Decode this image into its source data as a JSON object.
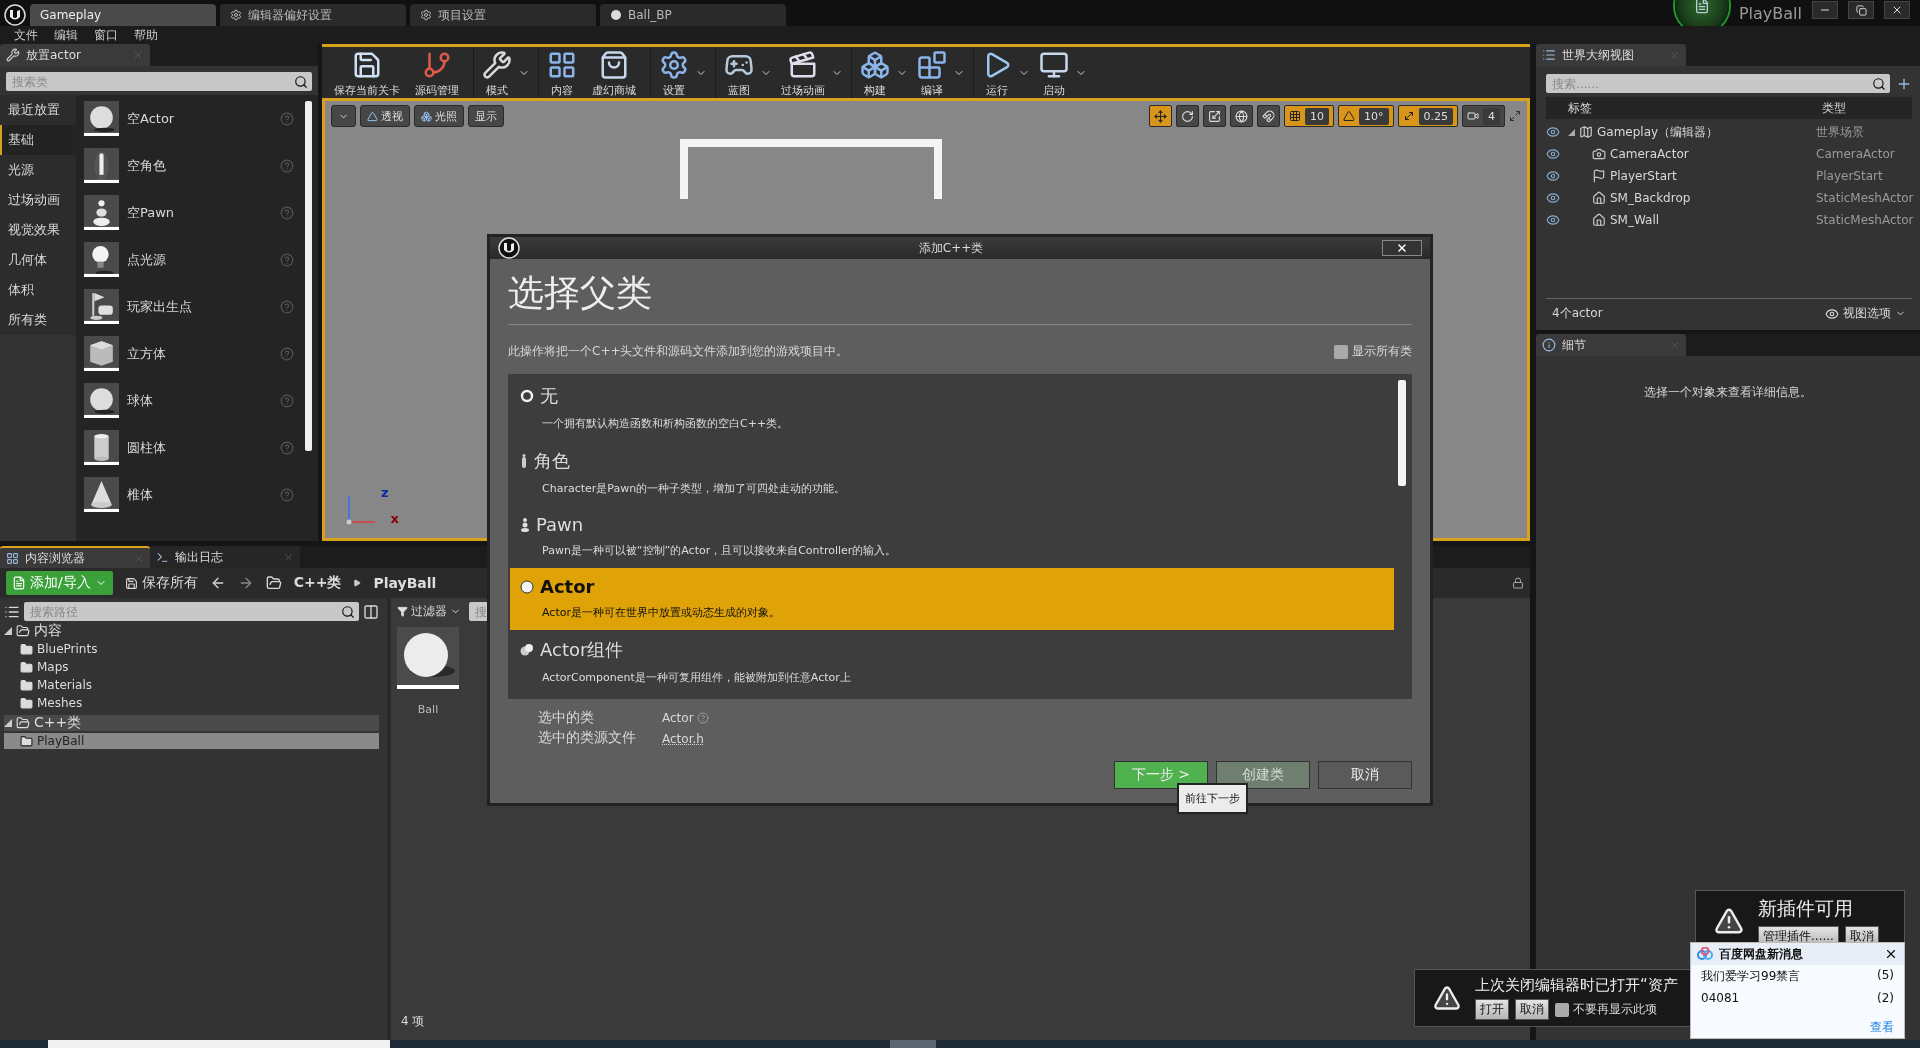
{
  "title_bar": {
    "tabs": [
      {
        "label": "Gameplay",
        "kind": "level",
        "selected": true
      },
      {
        "label": "编辑器偏好设置",
        "kind": "settings",
        "selected": false
      },
      {
        "label": "项目设置",
        "kind": "settings",
        "selected": false
      },
      {
        "label": "Ball_BP",
        "kind": "blueprint",
        "selected": false
      }
    ],
    "project": "PlayBall"
  },
  "menu": [
    "文件",
    "编辑",
    "窗口",
    "帮助"
  ],
  "place_panel": {
    "title": "放置actor",
    "search_placeholder": "搜索类",
    "categories": [
      {
        "label": "最近放置",
        "selected": false
      },
      {
        "label": "基础",
        "selected": true
      },
      {
        "label": "光源",
        "selected": false
      },
      {
        "label": "过场动画",
        "selected": false
      },
      {
        "label": "视觉效果",
        "selected": false
      },
      {
        "label": "几何体",
        "selected": false
      },
      {
        "label": "体积",
        "selected": false
      },
      {
        "label": "所有类",
        "selected": false
      }
    ],
    "items": [
      {
        "label": "空Actor",
        "kind": "sphere"
      },
      {
        "label": "空角色",
        "kind": "figure"
      },
      {
        "label": "空Pawn",
        "kind": "pawn"
      },
      {
        "label": "点光源",
        "kind": "bulb"
      },
      {
        "label": "玩家出生点",
        "kind": "flag"
      },
      {
        "label": "立方体",
        "kind": "cube"
      },
      {
        "label": "球体",
        "kind": "sphere"
      },
      {
        "label": "圆柱体",
        "kind": "cylinder"
      },
      {
        "label": "椎体",
        "kind": "cone"
      }
    ]
  },
  "toolbar": [
    {
      "label": "保存当前关卡",
      "kind": "save",
      "dropdown": false
    },
    {
      "label": "源码管理",
      "kind": "source",
      "dropdown": false
    },
    {
      "label": "模式",
      "kind": "modes",
      "dropdown": true
    },
    {
      "label": "内容",
      "kind": "content",
      "dropdown": false
    },
    {
      "label": "虚幻商城",
      "kind": "market",
      "dropdown": false
    },
    {
      "label": "设置",
      "kind": "settings",
      "dropdown": true
    },
    {
      "label": "蓝图",
      "kind": "blueprint",
      "dropdown": true
    },
    {
      "label": "过场动画",
      "kind": "cinematics",
      "dropdown": true
    },
    {
      "label": "构建",
      "kind": "build",
      "dropdown": true
    },
    {
      "label": "编译",
      "kind": "compile",
      "dropdown": true
    },
    {
      "label": "运行",
      "kind": "play",
      "dropdown": true
    },
    {
      "label": "启动",
      "kind": "launch",
      "dropdown": true
    }
  ],
  "viewport": {
    "view_buttons": [
      {
        "label": "透视",
        "kind": "perspective"
      },
      {
        "label": "光照",
        "kind": "lit"
      },
      {
        "label": "显示",
        "kind": "plain"
      }
    ],
    "tools": [
      {
        "kind": "move",
        "selected": true
      },
      {
        "kind": "rotate",
        "selected": false
      },
      {
        "kind": "scale",
        "selected": false
      },
      {
        "kind": "globe",
        "selected": false
      },
      {
        "kind": "surface",
        "selected": false
      }
    ],
    "snaps": [
      {
        "kind": "grid",
        "value": "10",
        "on": true
      },
      {
        "kind": "angle",
        "value": "10°",
        "on": true
      },
      {
        "kind": "scale",
        "value": "0.25",
        "on": true
      },
      {
        "kind": "camera",
        "value": "4",
        "on": false
      }
    ],
    "axes": [
      "z",
      "x"
    ]
  },
  "outliner": {
    "title": "世界大纲视图",
    "search_placeholder": "搜索......",
    "columns": [
      "标签",
      "类型"
    ],
    "tree": {
      "label": "Gameplay（编辑器）",
      "type": "世界场景",
      "kind": "world",
      "expanded": true,
      "children": [
        {
          "label": "CameraActor",
          "type": "CameraActor",
          "kind": "camera"
        },
        {
          "label": "PlayerStart",
          "type": "PlayerStart",
          "kind": "start"
        },
        {
          "label": "SM_Backdrop",
          "type": "StaticMeshActor",
          "kind": "mesh"
        },
        {
          "label": "SM_Wall",
          "type": "StaticMeshActor",
          "kind": "mesh"
        }
      ]
    },
    "count": "4个actor",
    "view_options": "视图选项"
  },
  "details": {
    "title": "细节",
    "message": "选择一个对象来查看详细信息。"
  },
  "content_browser": {
    "tabs": [
      {
        "label": "内容浏览器",
        "selected": true
      },
      {
        "label": "输出日志",
        "selected": false
      }
    ],
    "add_button": "添加/导入",
    "save_button": "保存所有",
    "path": [
      "C++类",
      "PlayBall"
    ],
    "path_search_placeholder": "搜索路径",
    "tree": [
      {
        "label": "内容",
        "expanded": true,
        "selected": false,
        "children": [
          {
            "label": "BluePrints",
            "selected": false
          },
          {
            "label": "Maps",
            "selected": false
          },
          {
            "label": "Materials",
            "selected": false
          },
          {
            "label": "Meshes",
            "selected": false
          }
        ]
      },
      {
        "label": "C++类",
        "expanded": true,
        "selected": false,
        "children": [
          {
            "label": "PlayBall",
            "selected": true
          }
        ]
      }
    ],
    "filter": "过滤器",
    "asset_search_placeholder": "搜",
    "assets": [
      {
        "name": "Ball"
      }
    ],
    "count": "4 项"
  },
  "dialog": {
    "title": "添加C++类",
    "heading": "选择父类",
    "description": "此操作将把一个C++头文件和源码文件添加到您的游戏项目中。",
    "show_all": {
      "label": "显示所有类",
      "checked": false
    },
    "classes": [
      {
        "name": "无",
        "kind": "none",
        "description": "一个拥有默认构造函数和析构函数的空白C++类。",
        "selected": false
      },
      {
        "name": "角色",
        "kind": "character",
        "description": "Character是Pawn的一种子类型，增加了可四处走动的功能。",
        "selected": false
      },
      {
        "name": "Pawn",
        "kind": "pawn",
        "description": "Pawn是一种可以被“控制”的Actor，且可以接收来自Controller的输入。",
        "selected": false
      },
      {
        "name": "Actor",
        "kind": "actor",
        "description": "Actor是一种可在世界中放置或动态生成的对象。",
        "selected": true
      },
      {
        "name": "Actor组件",
        "kind": "component",
        "description": "ActorComponent是一种可复用组件，能被附加到任意Actor上",
        "selected": false
      }
    ],
    "selected_class_label": "选中的类",
    "selected_class": "Actor",
    "source_file_label": "选中的类源文件",
    "source_file": "Actor.h",
    "buttons": [
      {
        "label": "下一步 >",
        "kind": "primary",
        "disabled": false
      },
      {
        "label": "创建类",
        "kind": "secondary",
        "disabled": true
      },
      {
        "label": "取消",
        "kind": "secondary",
        "disabled": false
      }
    ],
    "tooltip": "前往下一步"
  },
  "notifications": {
    "plugins": {
      "title": "新插件可用",
      "buttons": [
        "管理插件......",
        "取消"
      ]
    },
    "assets": {
      "message": "上次关闭编辑器时已打开“资产",
      "buttons": [
        "打开",
        "取消"
      ],
      "dont_show": {
        "label": "不要再显示此项",
        "checked": false
      }
    },
    "popup": {
      "title": "百度网盘新消息",
      "rows": [
        {
          "name": "我们爱学习99禁言",
          "count": "(5)"
        },
        {
          "name": "04081",
          "count": "(2)"
        }
      ],
      "link": "查看"
    }
  }
}
